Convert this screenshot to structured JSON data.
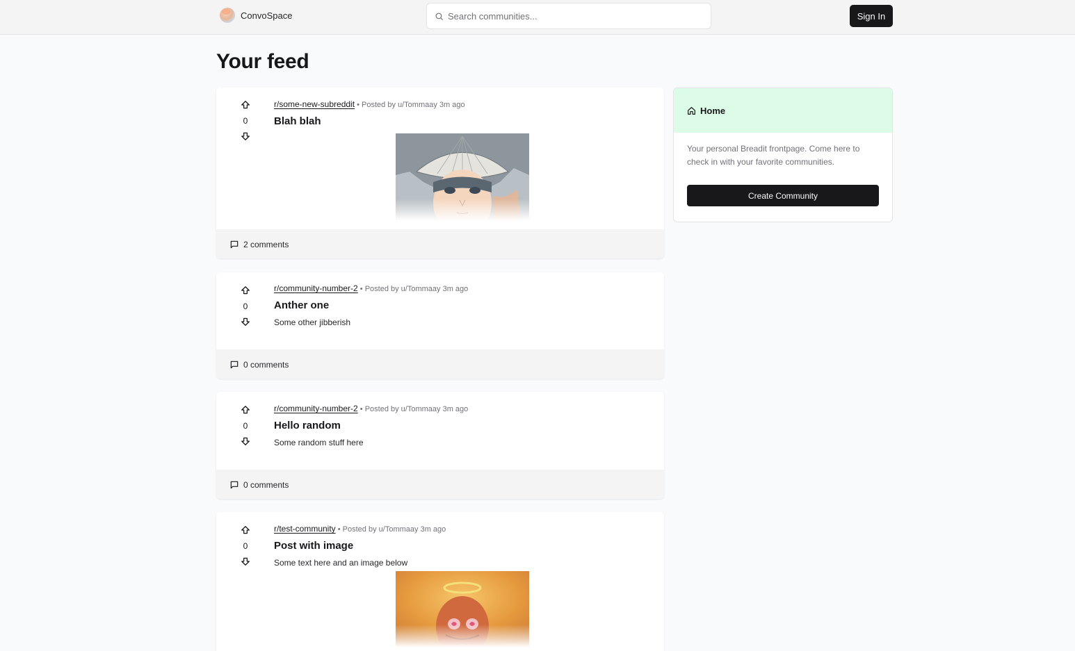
{
  "navbar": {
    "brand": "ConvoSpace",
    "search_placeholder": "Search communities...",
    "signin_label": "Sign In"
  },
  "feed": {
    "title": "Your feed",
    "posts": [
      {
        "subreddit": "r/some-new-subreddit",
        "separator": "•",
        "posted_by": "Posted by u/Tommaay",
        "time": "3m ago",
        "votes": "0",
        "title": "Blah blah",
        "text": "",
        "has_image": true,
        "image_icon": "anime-character-image",
        "comments": "2 comments"
      },
      {
        "subreddit": "r/community-number-2",
        "separator": "•",
        "posted_by": "Posted by u/Tommaay",
        "time": "3m ago",
        "votes": "0",
        "title": "Anther one",
        "text": "Some other jibberish",
        "has_image": false,
        "comments": "0 comments"
      },
      {
        "subreddit": "r/community-number-2",
        "separator": "•",
        "posted_by": "Posted by u/Tommaay",
        "time": "3m ago",
        "votes": "0",
        "title": "Hello random",
        "text": "Some random stuff here",
        "has_image": false,
        "comments": "0 comments"
      },
      {
        "subreddit": "r/test-community",
        "separator": "•",
        "posted_by": "Posted by u/Tommaay",
        "time": "3m ago",
        "votes": "0",
        "title": "Post with image",
        "text": "Some text here and an image below",
        "has_image": true,
        "image_icon": "haloed-character-image",
        "comments": ""
      }
    ]
  },
  "sidebar": {
    "title": "Home",
    "description": "Your personal Breadit frontpage. Come here to check in with your favorite communities.",
    "create_label": "Create Community"
  },
  "colors": {
    "accent_dark": "#18181b",
    "sidebar_header_bg": "#dcfce7",
    "page_bg": "#f8fafc",
    "muted_text": "#71717a"
  }
}
